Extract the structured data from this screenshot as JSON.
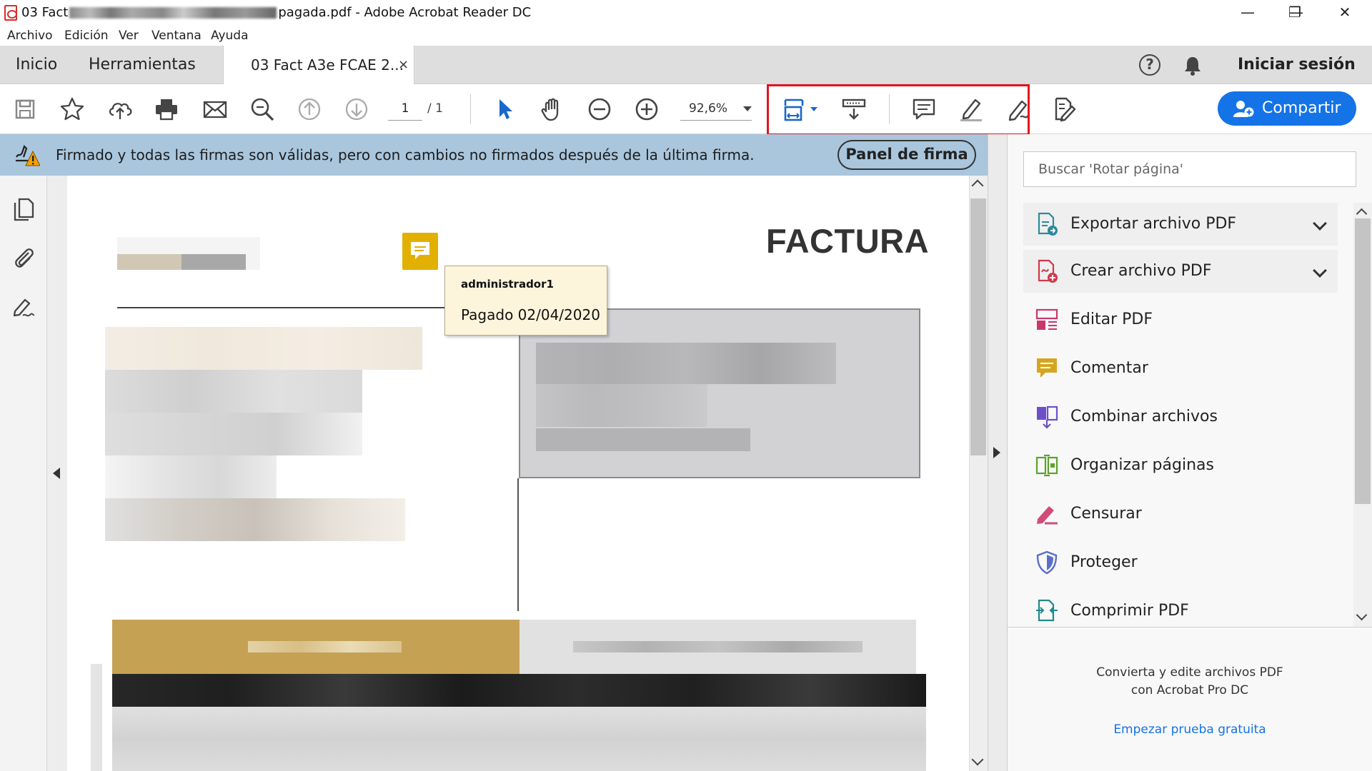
{
  "window": {
    "title_prefix": "03 Fact",
    "title_suffix": "pagada.pdf - Adobe Acrobat Reader DC",
    "controls": {
      "minimize": "—",
      "maximize": "❐",
      "close": "✕"
    }
  },
  "menu": [
    "Archivo",
    "Edición",
    "Ver",
    "Ventana",
    "Ayuda"
  ],
  "tabs": {
    "home": "Inicio",
    "tools": "Herramientas",
    "document": "03 Fact A3e FCAE 2...",
    "close": "×"
  },
  "header": {
    "help": "?",
    "signin": "Iniciar sesión"
  },
  "toolbar": {
    "page_current": "1",
    "page_total": "/ 1",
    "zoom": "92,6%",
    "share_label": "Compartir"
  },
  "signature_banner": {
    "message": "Firmado y todas las firmas son válidas, pero con cambios no firmados después de la última firma.",
    "panel_button": "Panel de firma"
  },
  "document": {
    "heading": "FACTURA",
    "comment": {
      "author": "administrador1",
      "text": "Pagado 02/04/2020"
    }
  },
  "right_panel": {
    "search_placeholder": "Buscar 'Rotar página'",
    "tools": [
      {
        "label": "Exportar archivo PDF",
        "icon": "export-pdf-icon",
        "expandable": true
      },
      {
        "label": "Crear archivo PDF",
        "icon": "create-pdf-icon",
        "expandable": true
      },
      {
        "label": "Editar PDF",
        "icon": "edit-pdf-icon",
        "expandable": false
      },
      {
        "label": "Comentar",
        "icon": "comment-icon",
        "expandable": false
      },
      {
        "label": "Combinar archivos",
        "icon": "combine-files-icon",
        "expandable": false
      },
      {
        "label": "Organizar páginas",
        "icon": "organize-pages-icon",
        "expandable": false
      },
      {
        "label": "Censurar",
        "icon": "redact-icon",
        "expandable": false
      },
      {
        "label": "Proteger",
        "icon": "protect-icon",
        "expandable": false
      },
      {
        "label": "Comprimir PDF",
        "icon": "compress-pdf-icon",
        "expandable": false
      }
    ],
    "promo_line1": "Convierta y edite archivos PDF",
    "promo_line2": "con Acrobat Pro DC",
    "trial_link": "Empezar prueba gratuita"
  },
  "colors": {
    "accent": "#1473e6",
    "banner": "#a9c6dd",
    "highlight_box": "#e4141d",
    "note": "#e1b000"
  }
}
